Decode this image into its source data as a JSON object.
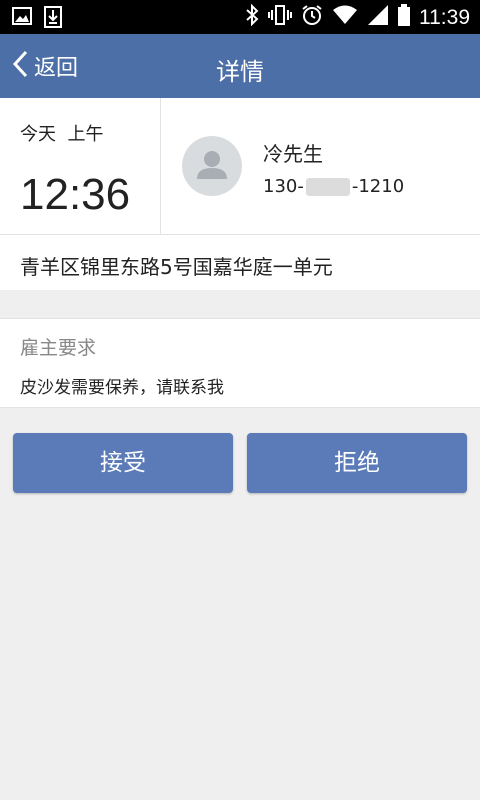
{
  "status_bar": {
    "left_icons": [
      "image-icon",
      "download-icon"
    ],
    "right_icons": [
      "bluetooth-icon",
      "vibrate-icon",
      "alarm-icon",
      "wifi-icon",
      "signal-icon",
      "battery-icon"
    ],
    "time": "11:39"
  },
  "header": {
    "back_label": "返回",
    "title": "详情",
    "bg_color": "#4d6fa8"
  },
  "order": {
    "day_label": "今天  上午",
    "time": "12:36",
    "customer_name": "冷先生",
    "phone_prefix": "130-",
    "phone_suffix": "-1210",
    "address": "青羊区锦里东路5号国嘉华庭一单元"
  },
  "requirement": {
    "label": "雇主要求",
    "text": "皮沙发需要保养，请联系我"
  },
  "actions": {
    "accept_label": "接受",
    "reject_label": "拒绝",
    "button_color": "#5a7ab8"
  }
}
